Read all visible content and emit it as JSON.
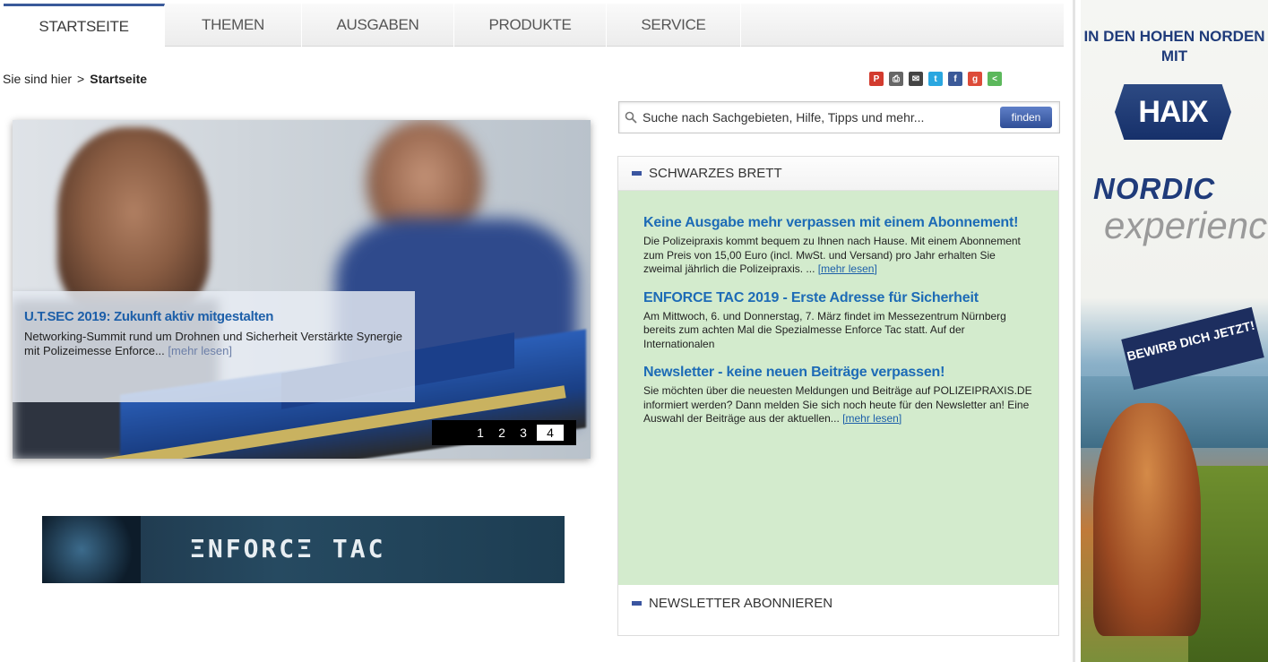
{
  "nav": {
    "tabs": [
      {
        "label": "STARTSEITE"
      },
      {
        "label": "THEMEN"
      },
      {
        "label": "AUSGABEN"
      },
      {
        "label": "PRODUKTE"
      },
      {
        "label": "SERVICE"
      }
    ],
    "active_tab": "STARTSEITE",
    "active_color": "#3a5a9a"
  },
  "breadcrumb": {
    "prefix": "Sie sind hier",
    "separator": ">",
    "current": "Startseite"
  },
  "share_icons": [
    {
      "name": "pdf-icon",
      "color": "#d23b2e",
      "glyph": "⎙"
    },
    {
      "name": "print-icon",
      "color": "#555555",
      "glyph": "⎙"
    },
    {
      "name": "email-icon",
      "color": "#444444",
      "glyph": "✉"
    },
    {
      "name": "twitter-icon",
      "color": "#2aa7e0",
      "glyph": "t"
    },
    {
      "name": "facebook-icon",
      "color": "#3b5998",
      "glyph": "f"
    },
    {
      "name": "googleplus-icon",
      "color": "#dd4b39",
      "glyph": "g"
    },
    {
      "name": "share-icon",
      "color": "#5cb85c",
      "glyph": "<"
    }
  ],
  "search": {
    "placeholder": "Suche nach Sachgebieten, Hilfe, Tipps und mehr...",
    "button_label": "finden"
  },
  "hero": {
    "title": "U.T.SEC 2019: Zukunft aktiv mitgestalten",
    "text": "Networking-Summit rund um Drohnen und Sicherheit Verstärkte Synergie mit Polizeimesse Enforce...",
    "more": "[mehr lesen]",
    "pages": [
      "1",
      "2",
      "3",
      "4"
    ],
    "active_page": "4"
  },
  "enforce_banner": {
    "text": "ΞNFORCΞ TAC"
  },
  "schwarzes_brett": {
    "title": "SCHWARZES BRETT",
    "items": [
      {
        "title": "Keine Ausgabe mehr verpassen mit einem Abonnement!",
        "text": "Die Polizeipraxis kommt bequem zu Ihnen nach Hause. Mit einem Abonnement zum Preis von 15,00 Euro (incl. MwSt. und Versand) pro Jahr erhalten Sie zweimal jährlich die Polizeipraxis. ...",
        "more": "[mehr lesen]"
      },
      {
        "title": "ENFORCE TAC 2019 - Erste Adresse für Sicherheit",
        "text": "Am Mittwoch, 6. und Donnerstag, 7. März findet im Messezentrum Nürnberg bereits zum achten Mal die Spezialmesse Enforce Tac statt. Auf der Internationalen",
        "more": ""
      },
      {
        "title": "Newsletter - keine neuen Beiträge verpassen!",
        "text": "Sie möchten über die neuesten Meldungen und Beiträge auf POLIZEIPRAXIS.DE informiert werden? Dann melden Sie sich noch heute für den Newsletter an! Eine Auswahl der Beiträge aus der aktuellen...",
        "more": "[mehr lesen]"
      }
    ],
    "bg_color": "#d3ebcd"
  },
  "newsletter": {
    "title": "NEWSLETTER ABONNIEREN"
  },
  "ad": {
    "headline": "IN DEN HOHEN NORDEN MIT",
    "logo": "HAIX",
    "nordic": "NORDIC",
    "experience": "experience",
    "cta": "BEWIRB DICH JETZT!"
  }
}
